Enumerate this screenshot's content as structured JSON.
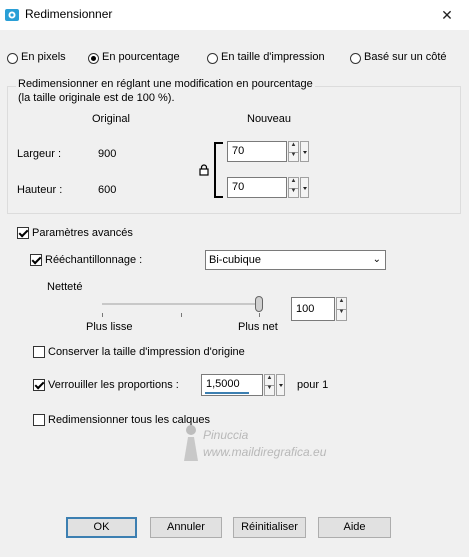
{
  "window": {
    "title": "Redimensionner",
    "close_glyph": "✕"
  },
  "mode": {
    "options": [
      {
        "label": "En pixels",
        "selected": false
      },
      {
        "label": "En pourcentage",
        "selected": true
      },
      {
        "label": "En taille d'impression",
        "selected": false
      },
      {
        "label": "Basé sur un côté",
        "selected": false
      }
    ]
  },
  "group": {
    "caption_line1": "Redimensionner en réglant une modification en pourcentage",
    "caption_line2": "(la taille originale est de 100 %).",
    "col_original": "Original",
    "col_new": "Nouveau",
    "width_label": "Largeur :",
    "width_original": "900",
    "width_new": "70",
    "height_label": "Hauteur :",
    "height_original": "600",
    "height_new": "70"
  },
  "advanced": {
    "label": "Paramètres avancés",
    "checked": true,
    "resample_label": "Rééchantillonnage :",
    "resample_checked": true,
    "resample_value": "Bi-cubique",
    "sharpness_label": "Netteté",
    "slider_min_label": "Plus lisse",
    "slider_max_label": "Plus net",
    "sharpness_value": "100",
    "sharpness_fraction": 1.0,
    "keep_print_size_label": "Conserver la taille d'impression d'origine",
    "keep_print_size_checked": false,
    "lock_ratio_label": "Verrouiller les proportions :",
    "lock_ratio_checked": true,
    "ratio_value": "1,5000",
    "ratio_suffix": "pour 1",
    "resize_all_layers_label": "Redimensionner tous les calques",
    "resize_all_layers_checked": false
  },
  "watermark": {
    "line1": "Pinuccia",
    "line2": "www.maildiregrafica.eu"
  },
  "buttons": {
    "ok": "OK",
    "cancel": "Annuler",
    "reset": "Réinitialiser",
    "help": "Aide"
  },
  "colors": {
    "accent": "#3c7fb1",
    "window_bg": "#f0f0f0",
    "field_underline": "#3c7fb1"
  }
}
